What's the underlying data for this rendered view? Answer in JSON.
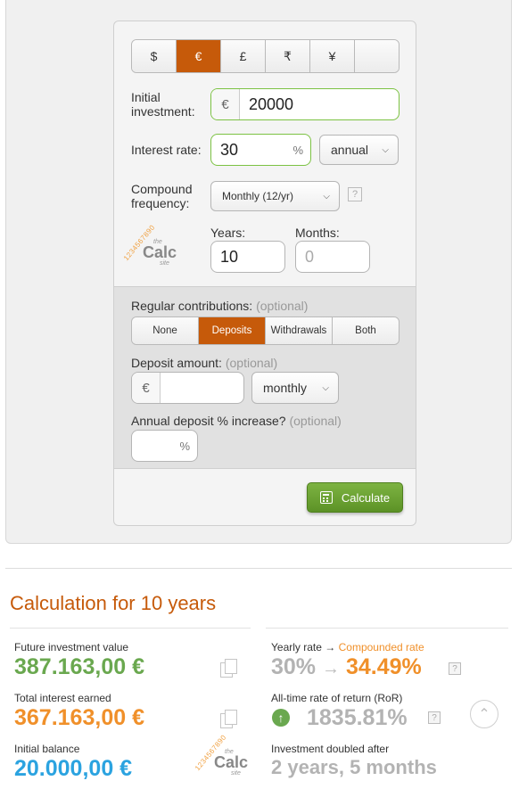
{
  "currencies": [
    "$",
    "€",
    "£",
    "₹",
    "¥",
    ""
  ],
  "active_currency": "€",
  "initial_investment": {
    "label": "Initial investment:",
    "prefix": "€",
    "value": "20000"
  },
  "interest_rate": {
    "label": "Interest rate:",
    "value": "30",
    "suffix": "%",
    "period": "annual"
  },
  "compound_frequency": {
    "label": "Compound frequency:",
    "value": "Monthly (12/yr)",
    "help": "?"
  },
  "logo": {
    "digits": "1234567890",
    "the": "the",
    "calc": "Calc",
    "site": "site"
  },
  "duration": {
    "years_label": "Years:",
    "years_value": "10",
    "months_label": "Months:",
    "months_placeholder": "0"
  },
  "contributions": {
    "label": "Regular contributions:",
    "optional": "(optional)",
    "options": [
      "None",
      "Deposits",
      "Withdrawals",
      "Both"
    ],
    "active": "Deposits",
    "deposit_label": "Deposit amount:",
    "deposit_prefix": "€",
    "deposit_value": "",
    "deposit_period": "monthly",
    "increase_label": "Annual deposit % increase?",
    "increase_suffix": "%"
  },
  "calculate_label": "Calculate",
  "results": {
    "title": "Calculation for 10 years",
    "future_value_label": "Future investment value",
    "future_value": "387.163,00 €",
    "total_interest_label": "Total interest earned",
    "total_interest": "367.163,00 €",
    "initial_balance_label": "Initial balance",
    "initial_balance": "20.000,00 €",
    "yearly_rate_label": "Yearly rate",
    "arrow": "→",
    "compounded_rate_label": "Compounded rate",
    "yearly_rate": "30%",
    "compounded_rate": "34.49%",
    "ror_label": "All-time rate of return (RoR)",
    "ror_value": "1835.81%",
    "doubled_label": "Investment doubled after",
    "doubled_value": "2 years, 5 months",
    "help": "?"
  },
  "colors": {
    "accent": "#c65a0a",
    "green": "#6aa84f",
    "orange": "#f0902a",
    "blue": "#2ba3e0",
    "grey": "#b3b3b3"
  },
  "icons": [
    "copy-icon",
    "calculator-icon",
    "arrow-up-icon",
    "chevron-up-icon",
    "chevron-down-icon"
  ]
}
